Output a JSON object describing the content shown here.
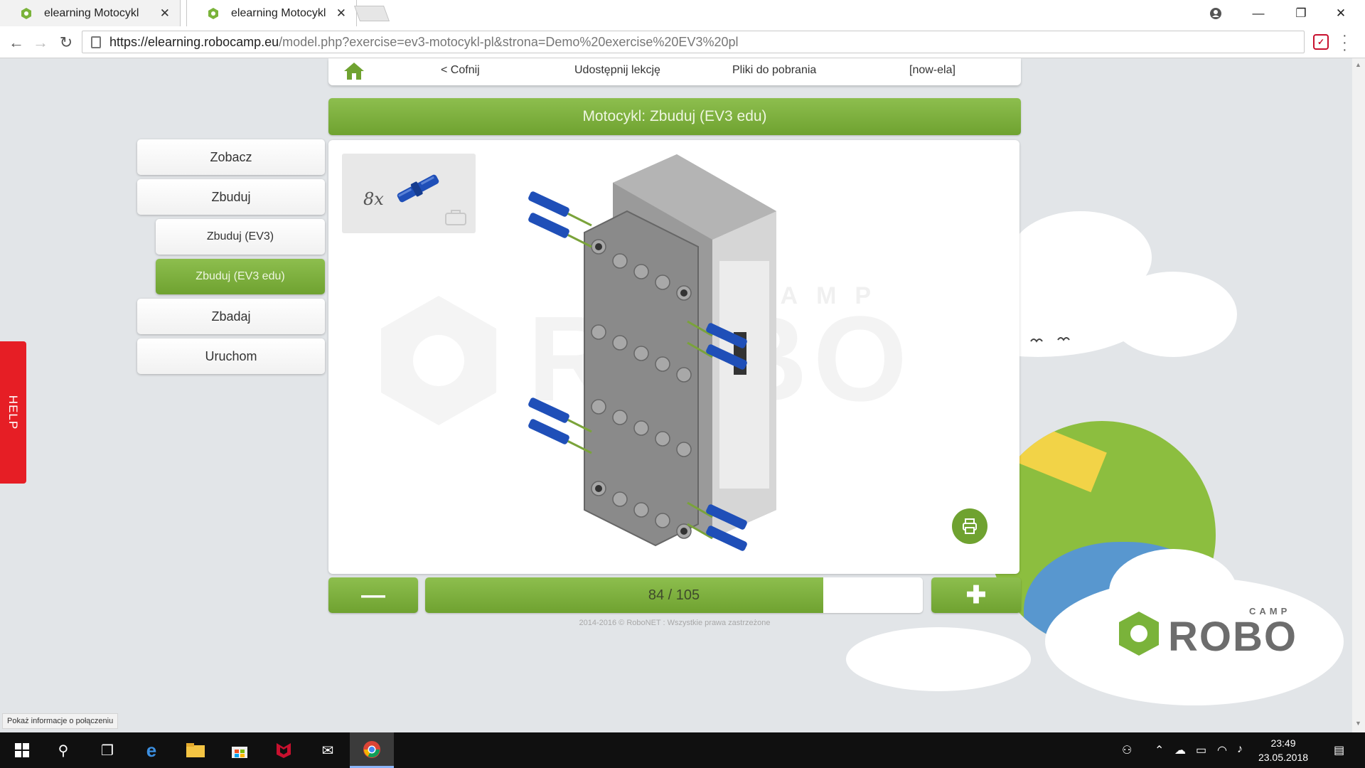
{
  "browser": {
    "tabs": [
      {
        "title": "elearning Motocykl",
        "close": "✕"
      },
      {
        "title": "elearning Motocykl",
        "close": "✕"
      }
    ],
    "url_host": "https://elearning.robocamp.eu",
    "url_path": "/model.php?exercise=ev3-motocykl-pl&strona=Demo%20exercise%20EV3%20pl",
    "window_controls": {
      "minimize": "—",
      "restore": "❐",
      "close": "✕"
    }
  },
  "topnav": {
    "back": "< Cofnij",
    "share": "Udostępnij lekcję",
    "downloads": "Pliki do pobrania",
    "user": "[now-ela]"
  },
  "title": "Motocykl: Zbuduj (EV3 edu)",
  "sidebar": {
    "items": [
      {
        "label": "Zobacz"
      },
      {
        "label": "Zbuduj"
      },
      {
        "label": "Zbuduj (EV3)"
      },
      {
        "label": "Zbuduj (EV3 edu)"
      },
      {
        "label": "Zbadaj"
      },
      {
        "label": "Uruchom"
      }
    ]
  },
  "parts": {
    "count": "8x",
    "part_color": "#1f4fb8"
  },
  "watermark": {
    "brand": "ROBO",
    "sub": "CAMP"
  },
  "stepper": {
    "label": "84 / 105",
    "current": 84,
    "total": 105,
    "minus": "—",
    "plus": "✚"
  },
  "copyright": "2014-2016 © RoboNET : Wszystkie prawa zastrzeżone",
  "help": "HELP",
  "logo": {
    "brand": "ROBO",
    "sub": "CAMP"
  },
  "status_bubble": "Pokaż informacje o połączeniu",
  "taskbar": {
    "time": "23:49",
    "date": "23.05.2018"
  },
  "colors": {
    "accent_green": "#6fa230",
    "help_red": "#e61e25"
  }
}
